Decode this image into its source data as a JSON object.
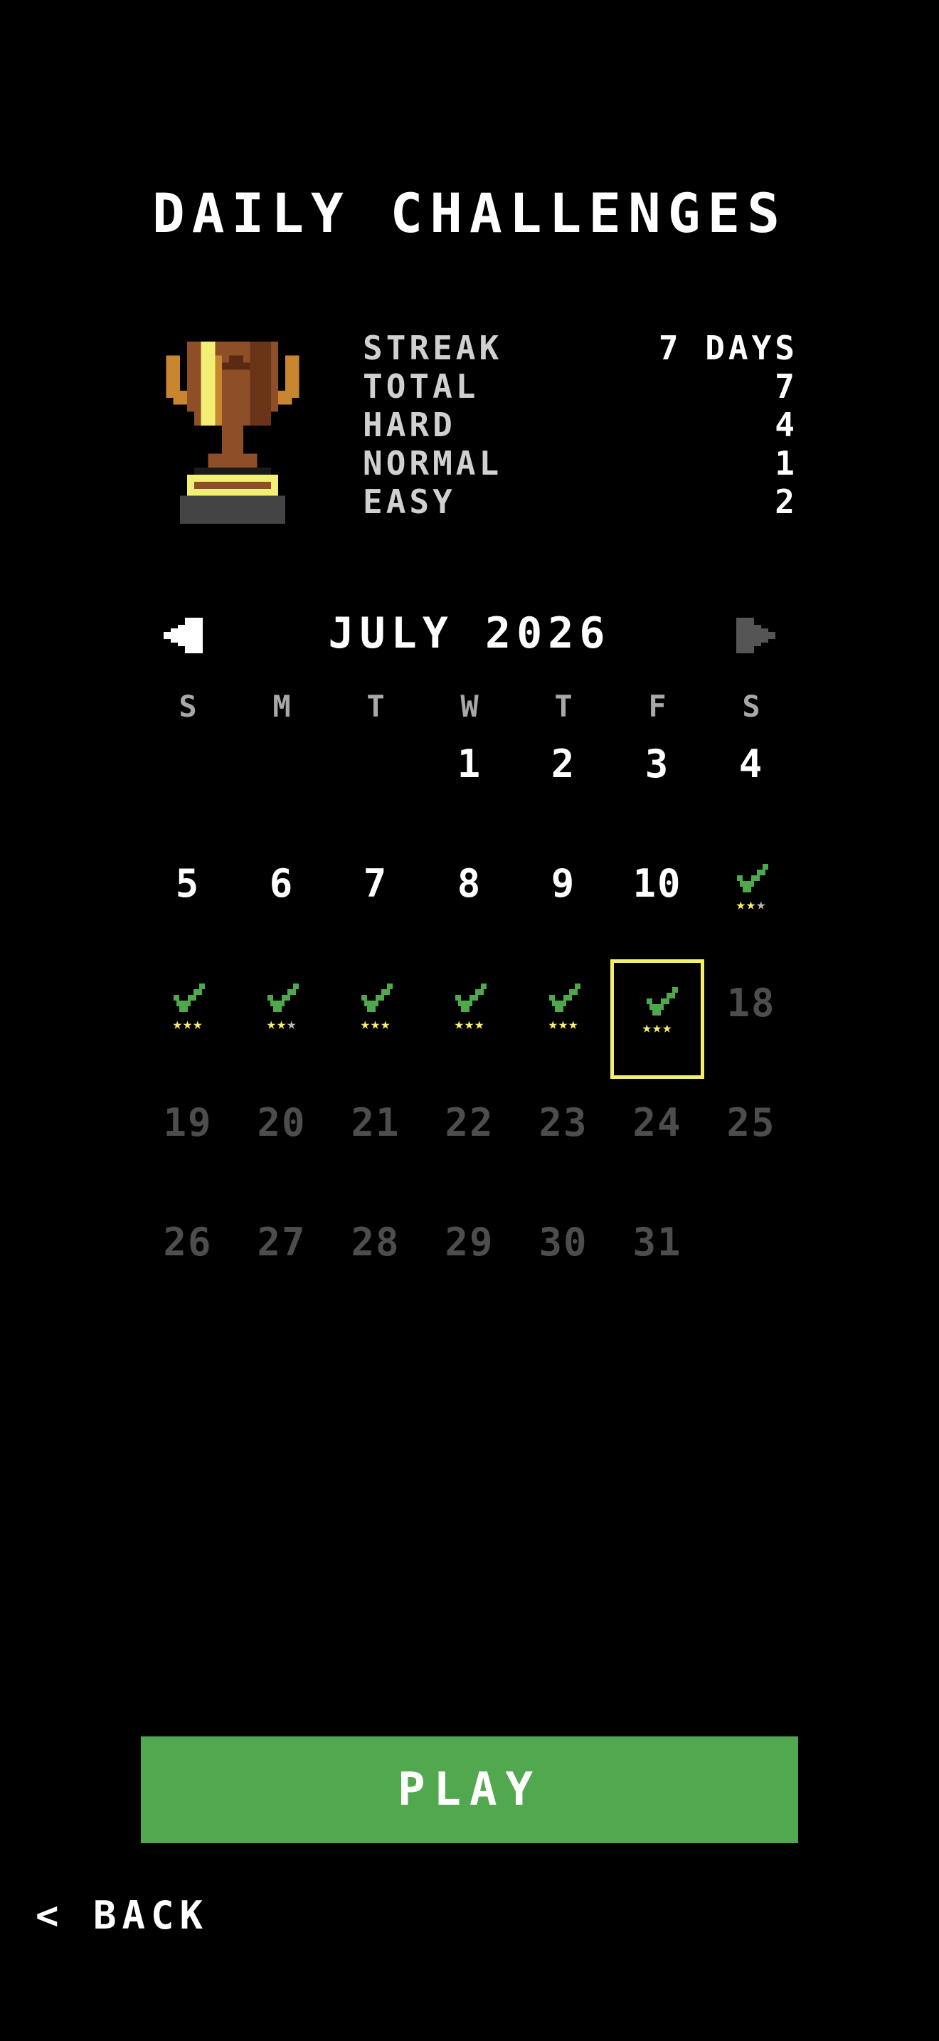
{
  "screen": {
    "title": "DAILY CHALLENGES"
  },
  "stats": [
    {
      "label": "STREAK",
      "value": "7 DAYS"
    },
    {
      "label": "TOTAL",
      "value": "7"
    },
    {
      "label": "HARD",
      "value": "4"
    },
    {
      "label": "NORMAL",
      "value": "1"
    },
    {
      "label": "EASY",
      "value": "2"
    }
  ],
  "calendar": {
    "month_label": "JULY 2026",
    "weekdays": [
      "S",
      "M",
      "T",
      "W",
      "T",
      "F",
      "S"
    ],
    "leading_blanks": 3,
    "days": [
      {
        "day": "1",
        "state": "available"
      },
      {
        "day": "2",
        "state": "available"
      },
      {
        "day": "3",
        "state": "available"
      },
      {
        "day": "4",
        "state": "available"
      },
      {
        "day": "5",
        "state": "available"
      },
      {
        "day": "6",
        "state": "available"
      },
      {
        "day": "7",
        "state": "available"
      },
      {
        "day": "8",
        "state": "available"
      },
      {
        "day": "9",
        "state": "available"
      },
      {
        "day": "10",
        "state": "available"
      },
      {
        "day": "11",
        "state": "completed",
        "stars": 2
      },
      {
        "day": "12",
        "state": "completed",
        "stars": 3
      },
      {
        "day": "13",
        "state": "completed",
        "stars": 2
      },
      {
        "day": "14",
        "state": "completed",
        "stars": 3
      },
      {
        "day": "15",
        "state": "completed",
        "stars": 3
      },
      {
        "day": "16",
        "state": "completed",
        "stars": 3
      },
      {
        "day": "17",
        "state": "completed",
        "stars": 3,
        "selected": true
      },
      {
        "day": "18",
        "state": "future"
      },
      {
        "day": "19",
        "state": "future"
      },
      {
        "day": "20",
        "state": "future"
      },
      {
        "day": "21",
        "state": "future"
      },
      {
        "day": "22",
        "state": "future"
      },
      {
        "day": "23",
        "state": "future"
      },
      {
        "day": "24",
        "state": "future"
      },
      {
        "day": "25",
        "state": "future"
      },
      {
        "day": "26",
        "state": "future"
      },
      {
        "day": "27",
        "state": "future"
      },
      {
        "day": "28",
        "state": "future"
      },
      {
        "day": "29",
        "state": "future"
      },
      {
        "day": "30",
        "state": "future"
      },
      {
        "day": "31",
        "state": "future"
      }
    ],
    "max_stars": 3,
    "prev_icon": "triangle-left-icon",
    "next_icon": "triangle-right-icon"
  },
  "buttons": {
    "play": "PLAY",
    "back": "< BACK"
  },
  "colors": {
    "check": "#4fa84c",
    "star_on": "#f7ec6e",
    "star_off": "#b8b8b8",
    "selected_border": "#f2ee6e",
    "play_bg": "#52a84e",
    "future_text": "#4d4d4d"
  }
}
